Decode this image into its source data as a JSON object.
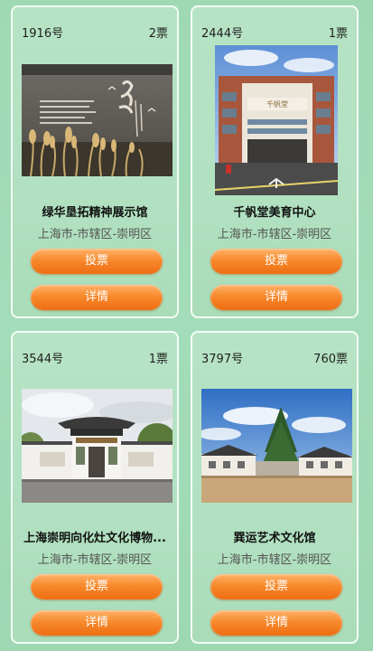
{
  "cards": [
    {
      "number": "1916号",
      "votes": "2票",
      "title": "绿华垦拓精神展示馆",
      "region": "上海市-市辖区-崇明区",
      "vote_label": "投票",
      "detail_label": "详情"
    },
    {
      "number": "2444号",
      "votes": "1票",
      "title": "千帆堂美育中心",
      "region": "上海市-市辖区-崇明区",
      "vote_label": "投票",
      "detail_label": "详情"
    },
    {
      "number": "3544号",
      "votes": "1票",
      "title": "上海崇明向化灶文化博物...",
      "region": "上海市-市辖区-崇明区",
      "vote_label": "投票",
      "detail_label": "详情"
    },
    {
      "number": "3797号",
      "votes": "760票",
      "title": "巽运艺术文化馆",
      "region": "上海市-市辖区-崇明区",
      "vote_label": "投票",
      "detail_label": "详情"
    }
  ],
  "colors": {
    "background": "#a3dcb8",
    "button_orange": "#f78a2d"
  }
}
